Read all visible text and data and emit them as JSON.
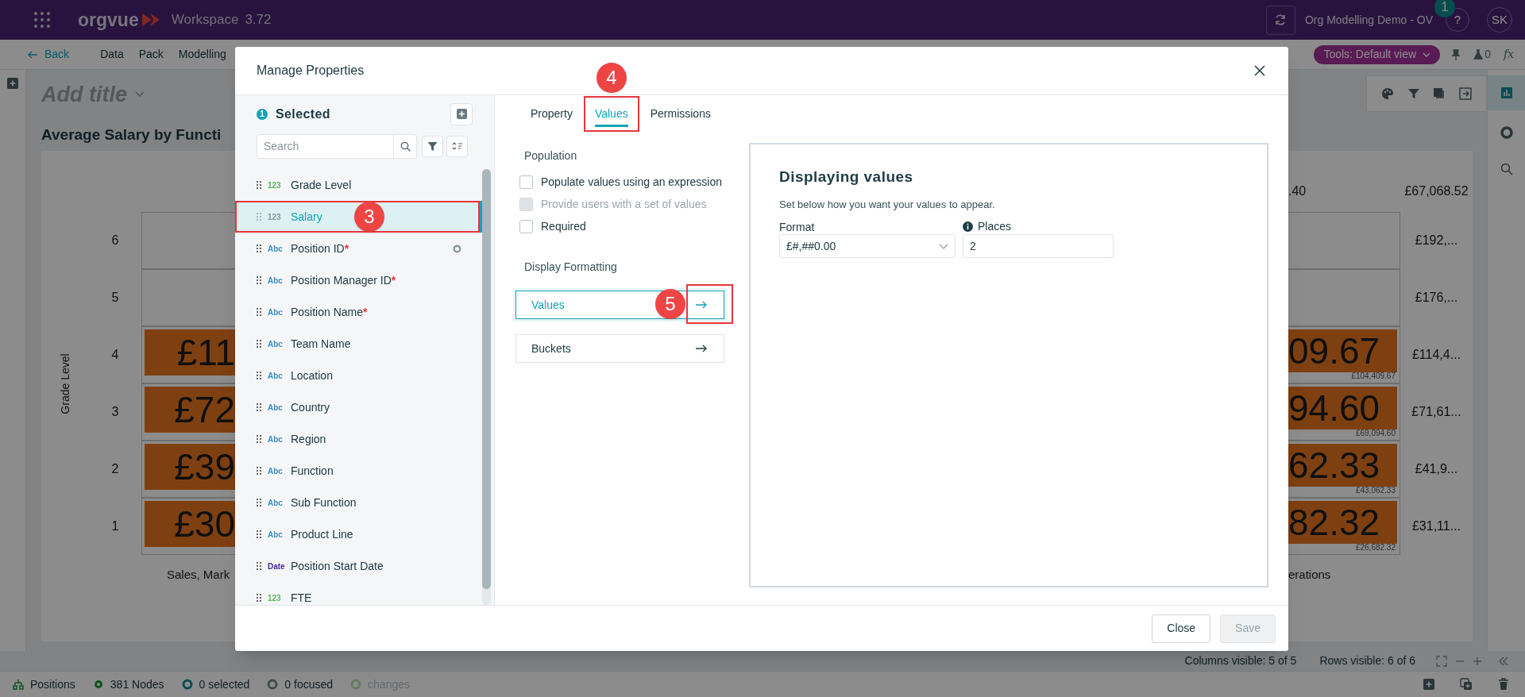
{
  "top_bar": {
    "app_name": "orgvue",
    "workspace": "Workspace",
    "version": "3.72",
    "project": "Org Modelling Demo - OV",
    "help": "?",
    "help_badge": "1",
    "user_initials": "SK"
  },
  "nav_bar": {
    "back": "Back",
    "menu": [
      "Data",
      "Pack",
      "Modelling"
    ],
    "tools_view": "Tools: Default view",
    "flask_count": "0",
    "formula": "fx"
  },
  "canvas": {
    "title_placeholder": "Add title",
    "chart_title": "Average Salary by Functi",
    "y_axis_label": "Grade Level",
    "top_totals": [
      ".40",
      "£67,068.52"
    ],
    "rows": [
      {
        "grade": "6",
        "filled": false,
        "total": "£192,..."
      },
      {
        "grade": "5",
        "filled": false,
        "total": "£176,..."
      },
      {
        "grade": "4",
        "filled": true,
        "left_value": "£11",
        "right_value": "09.67",
        "right_caption": "£104,409.67",
        "total": "£114,4..."
      },
      {
        "grade": "3",
        "filled": true,
        "left_value": "£72",
        "right_value": "94.60",
        "right_caption": "£69,094.60",
        "total": "£71,61..."
      },
      {
        "grade": "2",
        "filled": true,
        "left_value": "£39",
        "right_value": "62.33",
        "right_caption": "£43,062.33",
        "total": "£41,9..."
      },
      {
        "grade": "1",
        "filled": true,
        "left_value": "£30",
        "right_value": "82.32",
        "right_caption": "£26,682.32",
        "total": "£31,11..."
      }
    ],
    "left_column_label": "Sales, Mark",
    "right_column_label": "erations"
  },
  "grid_footer": {
    "columns_visible": "Columns visible: 5 of 5",
    "rows_visible": "Rows visible: 6 of 6"
  },
  "status_bar": [
    {
      "kind": "dataset",
      "label": "Positions",
      "disabled": false
    },
    {
      "kind": "nodes",
      "label": "381 Nodes",
      "disabled": false
    },
    {
      "kind": "selected",
      "label": "0 selected",
      "disabled": false
    },
    {
      "kind": "focused",
      "label": "0 focused",
      "disabled": false
    },
    {
      "kind": "changes",
      "label": "changes",
      "disabled": true
    }
  ],
  "modal": {
    "title": "Manage Properties",
    "selected_count": "1",
    "selected_label": "Selected",
    "search_placeholder": "Search",
    "properties": [
      {
        "kind": "number",
        "type_label": "123",
        "name": "Grade Level",
        "selected": false,
        "indicator": false
      },
      {
        "kind": "number",
        "type_label": "123",
        "name": "Salary",
        "selected": true,
        "indicator": false,
        "callout": "3"
      },
      {
        "kind": "text",
        "type_label": "Abc",
        "name": "Position ID",
        "required_mark": "*",
        "selected": false,
        "indicator": true
      },
      {
        "kind": "text",
        "type_label": "Abc",
        "name": "Position Manager ID",
        "required_mark": "*",
        "selected": false,
        "indicator": false
      },
      {
        "kind": "text",
        "type_label": "Abc",
        "name": "Position Name",
        "required_mark": "*",
        "selected": false,
        "indicator": false
      },
      {
        "kind": "text",
        "type_label": "Abc",
        "name": "Team Name",
        "selected": false,
        "indicator": false
      },
      {
        "kind": "text",
        "type_label": "Abc",
        "name": "Location",
        "selected": false,
        "indicator": false
      },
      {
        "kind": "text",
        "type_label": "Abc",
        "name": "Country",
        "selected": false,
        "indicator": false
      },
      {
        "kind": "text",
        "type_label": "Abc",
        "name": "Region",
        "selected": false,
        "indicator": false
      },
      {
        "kind": "text",
        "type_label": "Abc",
        "name": "Function",
        "selected": false,
        "indicator": false
      },
      {
        "kind": "text",
        "type_label": "Abc",
        "name": "Sub Function",
        "selected": false,
        "indicator": false
      },
      {
        "kind": "text",
        "type_label": "Abc",
        "name": "Product Line",
        "selected": false,
        "indicator": false
      },
      {
        "kind": "date",
        "type_label": "Date",
        "name": "Position Start Date",
        "selected": false,
        "indicator": false
      },
      {
        "kind": "number",
        "type_label": "123",
        "name": "FTE",
        "selected": false,
        "indicator": false
      }
    ],
    "tabs": [
      {
        "label": "Property",
        "selected": false
      },
      {
        "label": "Values",
        "selected": true,
        "callout": "4"
      },
      {
        "label": "Permissions",
        "selected": false
      }
    ],
    "population": {
      "heading": "Population",
      "options": [
        {
          "label": "Populate values using an expression",
          "checked": false,
          "disabled": false
        },
        {
          "label": "Provide users with a set of values",
          "checked": false,
          "disabled": true
        },
        {
          "label": "Required",
          "checked": false,
          "disabled": false
        }
      ]
    },
    "display_formatting": {
      "heading": "Display Formatting",
      "items": [
        {
          "label": "Values",
          "selected": true,
          "callout": "5"
        },
        {
          "label": "Buckets",
          "selected": false
        }
      ]
    },
    "panel": {
      "title": "Displaying values",
      "description": "Set below how you want your values to appear.",
      "format_label": "Format",
      "format_value": "£#,##0.00",
      "places_label": "Places",
      "places_value": "2"
    },
    "buttons": [
      {
        "label": "Close",
        "disabled": false
      },
      {
        "label": "Save",
        "disabled": true
      }
    ]
  }
}
